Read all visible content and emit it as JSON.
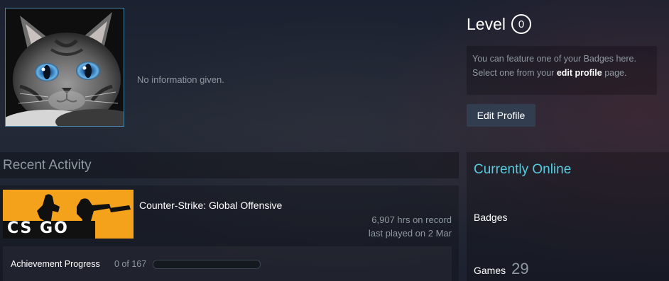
{
  "profile": {
    "summary": "No information given.",
    "avatar_icon": "cat-avatar"
  },
  "level": {
    "label": "Level",
    "value": "0"
  },
  "badge_feature": {
    "line1": "You can feature one of your Badges here.",
    "line2_prefix": "Select one from your ",
    "link_text": "edit profile",
    "line2_suffix": " page."
  },
  "edit_profile_label": "Edit Profile",
  "recent_activity": {
    "title": "Recent Activity",
    "game": {
      "name": "Counter-Strike: Global Offensive",
      "capsule_text": "CS GO",
      "hours": "6,907 hrs on record",
      "last_played": "last played on 2 Mar",
      "achievement_label": "Achievement Progress",
      "achievement_count": "0 of 167",
      "achievement_fraction": 0
    }
  },
  "right_column": {
    "online_status": "Currently Online",
    "badges_label": "Badges",
    "games_label": "Games",
    "games_count": "29"
  },
  "colors": {
    "online": "#57cbde",
    "button_bg": "#323e4f",
    "capsule_orange": "#f4a21c"
  }
}
